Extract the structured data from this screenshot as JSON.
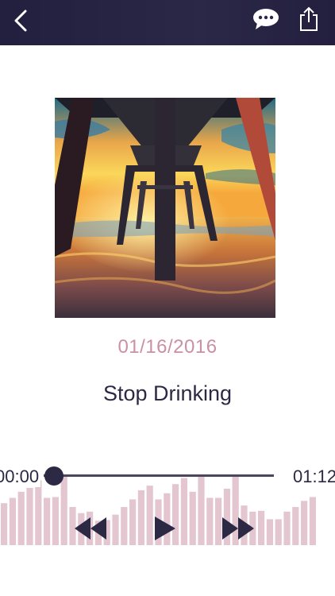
{
  "nav": {
    "back_icon": "chevron-left-icon",
    "comment_icon": "speech-bubble-icon",
    "share_icon": "share-icon"
  },
  "recording": {
    "date": "01/16/2016",
    "title": "Stop Drinking"
  },
  "player": {
    "elapsed": "00:00",
    "duration": "01:12",
    "progress": 0,
    "waveform_levels": [
      0.55,
      0.62,
      0.7,
      0.75,
      0.85,
      0.62,
      0.63,
      0.9,
      0.5,
      0.42,
      0.44,
      0.32,
      0.33,
      0.4,
      0.5,
      0.6,
      0.72,
      0.78,
      0.6,
      0.68,
      0.8,
      0.88,
      0.7,
      0.9,
      0.62,
      0.62,
      0.74,
      0.9,
      0.52,
      0.44,
      0.45,
      0.34,
      0.34,
      0.44,
      0.5,
      0.58,
      0.63
    ],
    "colors": {
      "bar": "#e4c6d1",
      "accent": "#2b2944",
      "date": "#cc8fa3"
    }
  }
}
